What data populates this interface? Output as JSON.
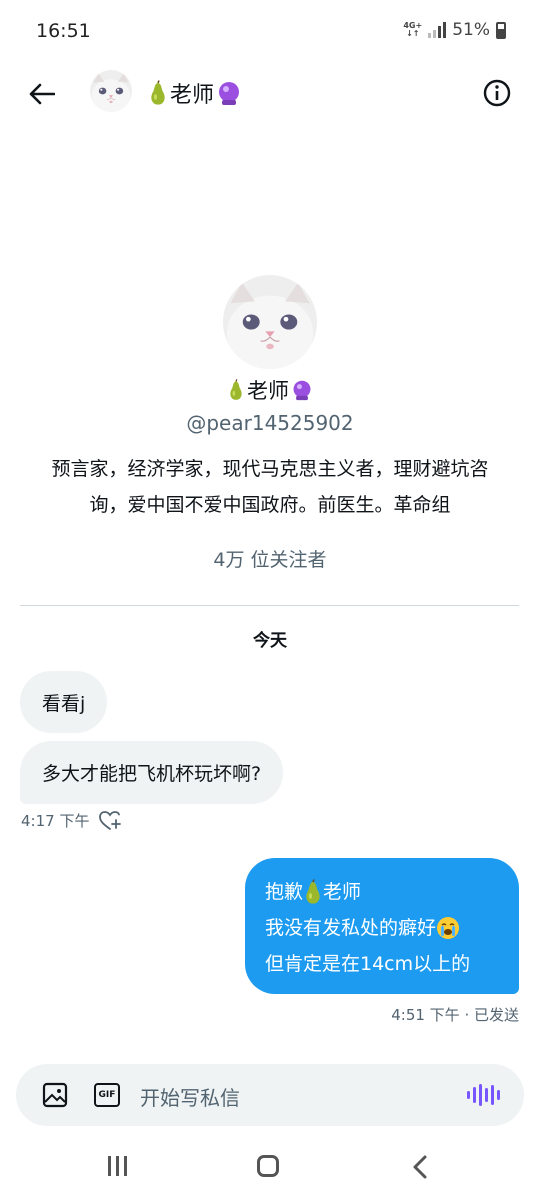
{
  "status_bar": {
    "time": "16:51",
    "network": "4G+",
    "battery": "51%"
  },
  "header": {
    "name": "老师"
  },
  "profile": {
    "name": "老师",
    "handle": "@pear14525902",
    "bio": "预言家，经济学家，现代马克思主义者，理财避坑咨询，爱中国不爱中国政府。前医生。革命组",
    "followers": "4万 位关注者"
  },
  "conversation": {
    "date_separator": "今天",
    "incoming": [
      {
        "text": "看看j"
      },
      {
        "text": "多大才能把飞机杯玩坏啊?"
      }
    ],
    "incoming_time": "4:17 下午",
    "outgoing": {
      "line1_prefix": "抱歉",
      "line1_suffix": "老师",
      "line2": "我没有发私处的癖好",
      "line3": "但肯定是在14cm以上的"
    },
    "outgoing_meta": "4:51 下午 · 已发送"
  },
  "composer": {
    "placeholder": "开始写私信",
    "gif_label": "GIF"
  },
  "colors": {
    "accent": "#1d9bf0",
    "incoming_bubble": "#eff3f4",
    "voice": "#7856ff",
    "secondary_text": "#536471"
  },
  "icons": [
    "back-arrow-icon",
    "info-icon",
    "heart-plus-icon",
    "image-icon",
    "gif-icon",
    "voice-icon",
    "recent-apps-icon",
    "home-icon",
    "nav-back-icon"
  ]
}
